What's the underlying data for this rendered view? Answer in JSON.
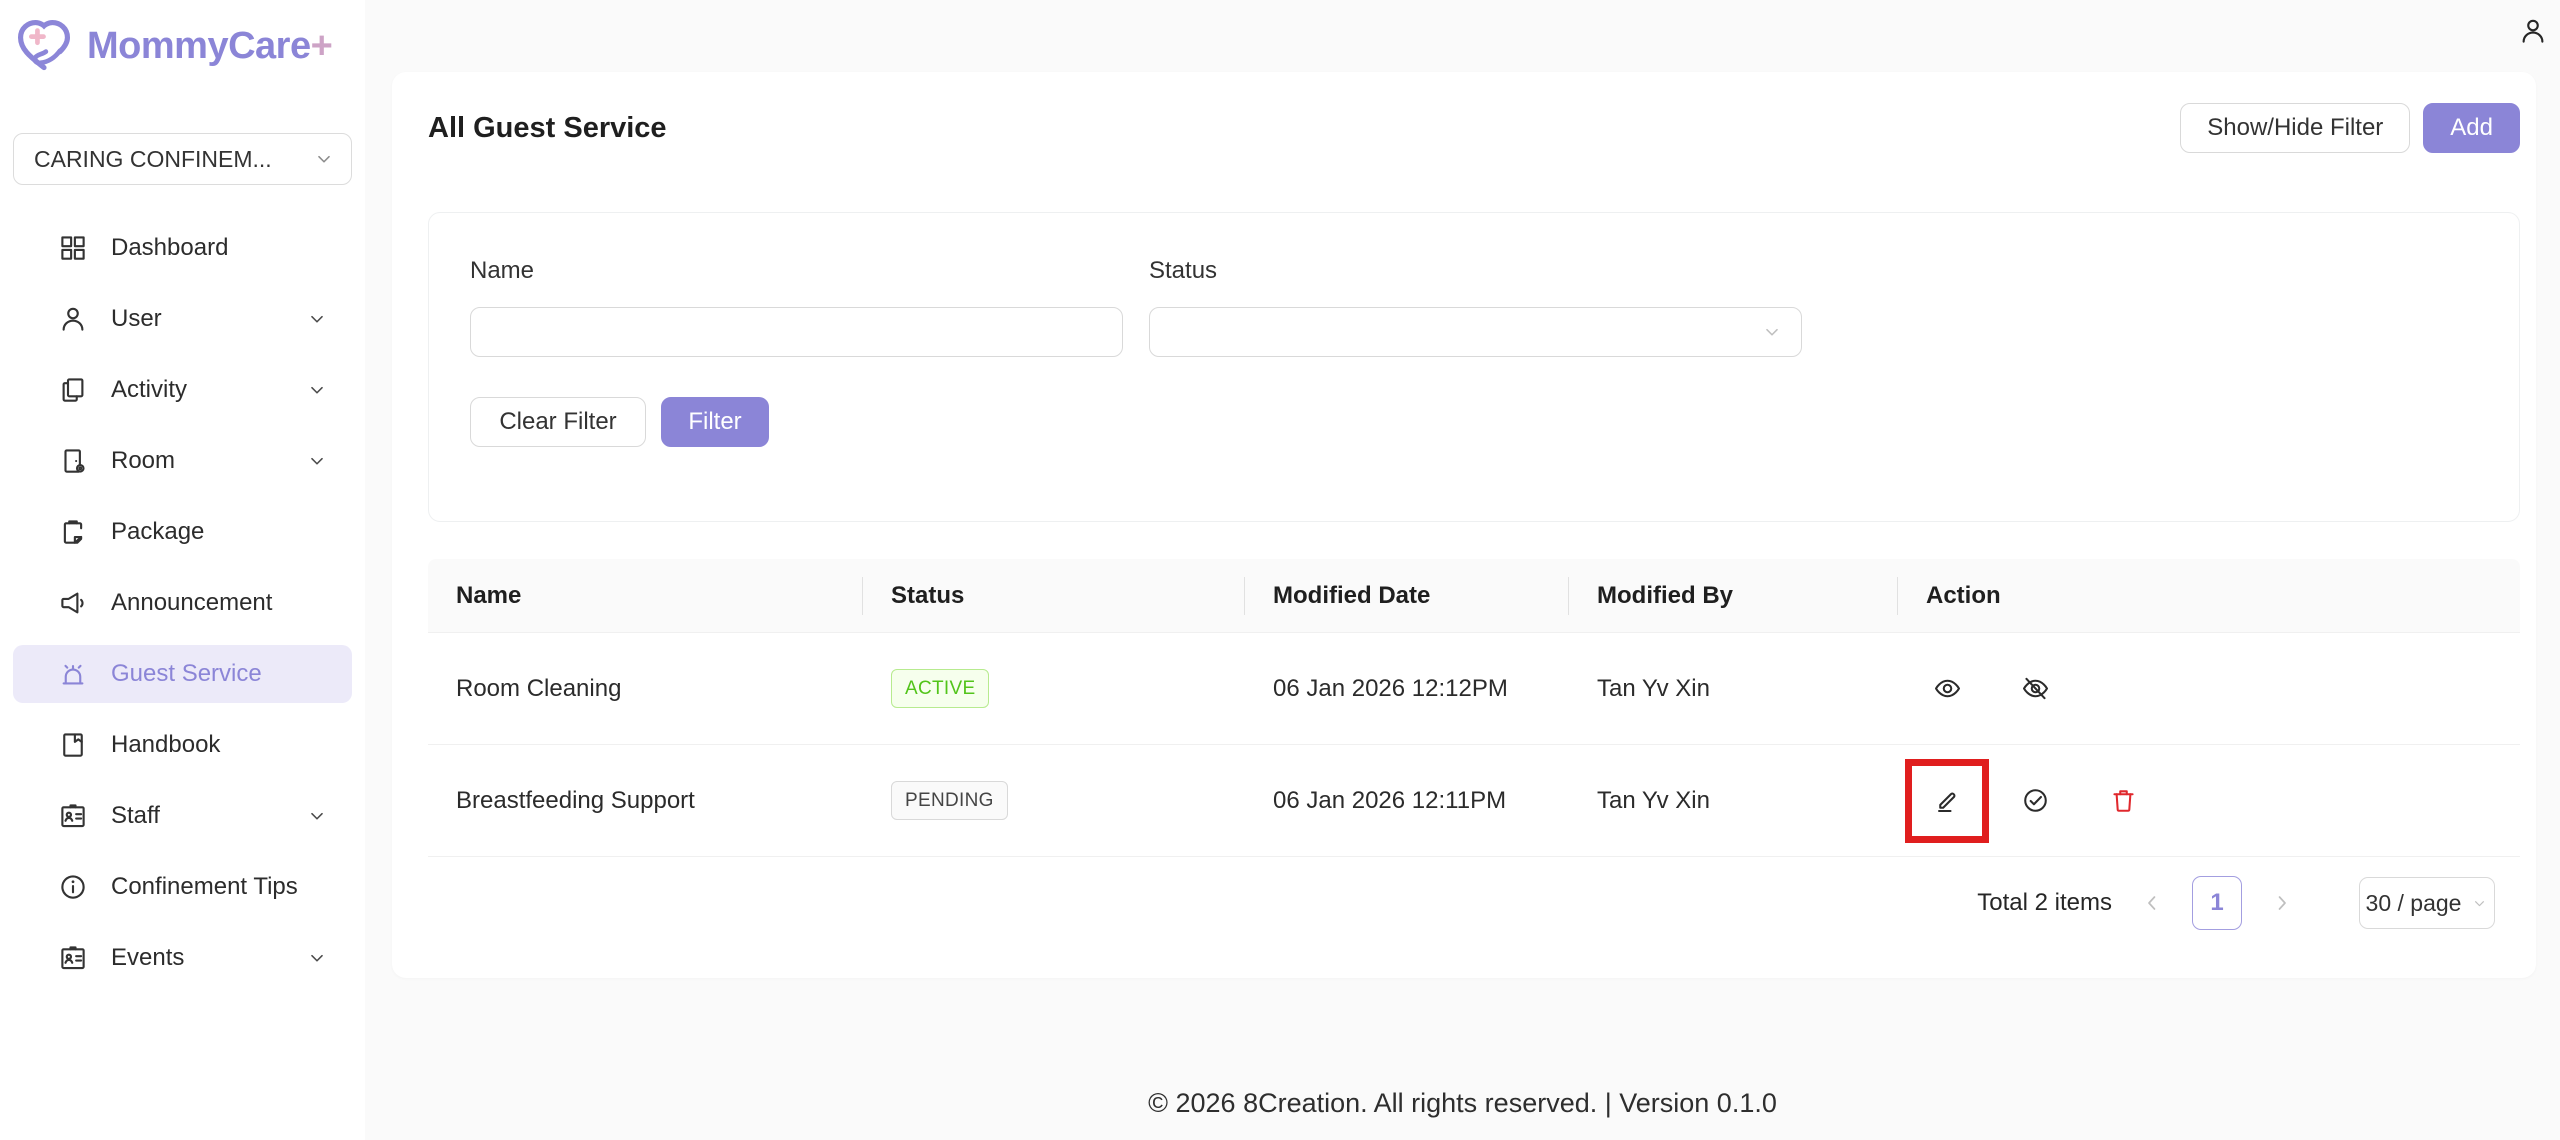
{
  "brand": {
    "name": "MommyCare",
    "plus": "+"
  },
  "header": {
    "profile_icon": "user-icon"
  },
  "sidebar": {
    "venue_selector": {
      "value": "CARING CONFINEM...",
      "icon": "chevron-down-icon"
    },
    "items": [
      {
        "label": "Dashboard",
        "icon": "dashboard-grid-icon",
        "expandable": false,
        "active": false
      },
      {
        "label": "User",
        "icon": "user-icon",
        "expandable": true,
        "active": false
      },
      {
        "label": "Activity",
        "icon": "activity-pages-icon",
        "expandable": true,
        "active": false
      },
      {
        "label": "Room",
        "icon": "room-door-icon",
        "expandable": true,
        "active": false
      },
      {
        "label": "Package",
        "icon": "package-clipboard-icon",
        "expandable": false,
        "active": false
      },
      {
        "label": "Announcement",
        "icon": "megaphone-icon",
        "expandable": false,
        "active": false
      },
      {
        "label": "Guest Service",
        "icon": "service-bell-icon",
        "expandable": false,
        "active": true
      },
      {
        "label": "Handbook",
        "icon": "handbook-icon",
        "expandable": false,
        "active": false
      },
      {
        "label": "Staff",
        "icon": "id-card-icon",
        "expandable": true,
        "active": false
      },
      {
        "label": "Confinement Tips",
        "icon": "info-circle-icon",
        "expandable": false,
        "active": false
      },
      {
        "label": "Events",
        "icon": "events-badge-icon",
        "expandable": true,
        "active": false
      }
    ]
  },
  "page_header": {
    "title": "All Guest Service",
    "show_hide_filter_label": "Show/Hide Filter",
    "add_label": "Add"
  },
  "filter": {
    "name_label": "Name",
    "name_value": "",
    "name_placeholder": "",
    "status_label": "Status",
    "status_value": "",
    "clear_label": "Clear Filter",
    "apply_label": "Filter"
  },
  "table": {
    "columns": [
      "Name",
      "Status",
      "Modified Date",
      "Modified By",
      "Action"
    ],
    "rows": [
      {
        "name": "Room Cleaning",
        "status": "ACTIVE",
        "modified_date": "06 Jan 2026 12:12PM",
        "modified_by": "Tan Yv Xin",
        "actions": [
          "eye-icon",
          "eye-invisible-icon"
        ],
        "highlight": null
      },
      {
        "name": "Breastfeeding Support",
        "status": "PENDING",
        "modified_date": "06 Jan 2026 12:11PM",
        "modified_by": "Tan Yv Xin",
        "actions": [
          "edit-icon",
          "check-circle-icon",
          "delete-icon"
        ],
        "highlight": "edit-icon"
      }
    ]
  },
  "pagination": {
    "total_text": "Total 2 items",
    "current_page": "1",
    "page_size": "30 / page"
  },
  "footer": {
    "text": "© 2026 8Creation. All rights reserved. | Version 0.1.0"
  },
  "colors": {
    "primary": "#8B85D7",
    "primary_light_bg": "#ECEAF9",
    "logo_plus_pink": "#CDA3C6",
    "logo_cross_pink": "#F0B7C9",
    "active_badge_text": "#52C41A",
    "active_badge_border": "#B7EB8F",
    "active_badge_bg": "#F6FFED",
    "pending_badge_text": "#454545",
    "pending_badge_border": "#D9D9D9",
    "pending_badge_bg": "#FAFAFA",
    "danger_red": "#E0282D",
    "annotation_red": "#E01E1E"
  }
}
